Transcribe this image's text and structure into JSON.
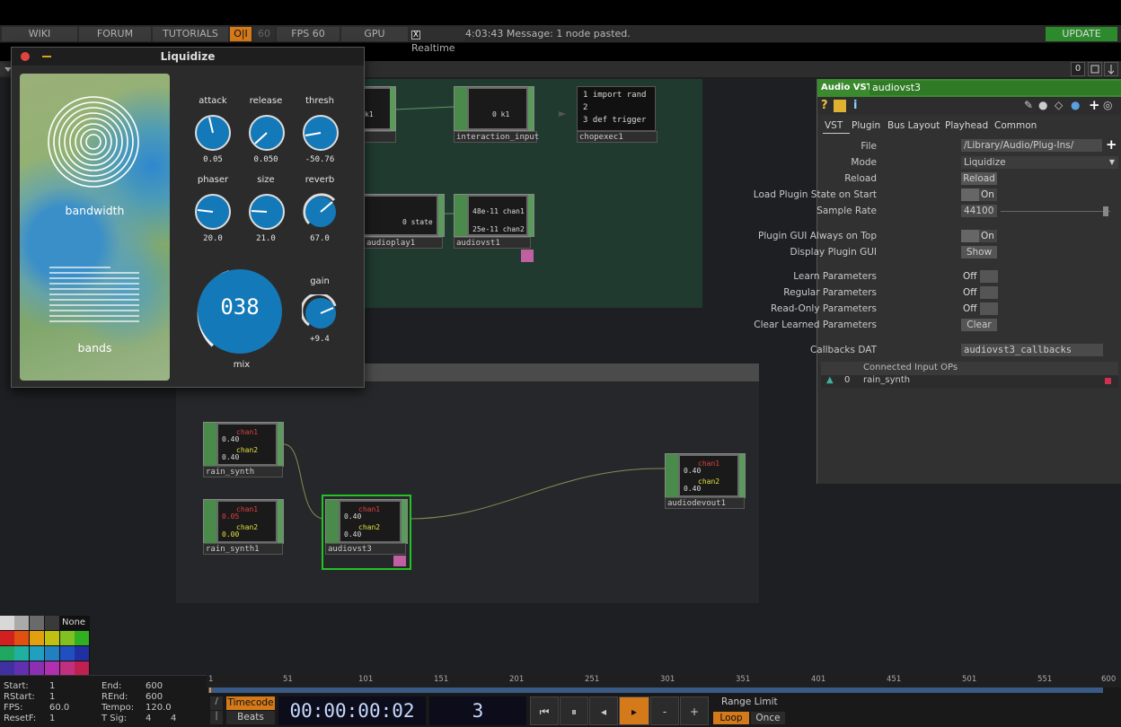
{
  "menubar": {
    "wiki": "WIKI",
    "forum": "FORUM",
    "tutorials": "TUTORIALS",
    "oi": "O|I",
    "oi_num": "60",
    "fps": "FPS  60",
    "gpu": "GPU",
    "realtime": "Realtime",
    "realtime_checked": "X",
    "status": "4:03:43 Message: 1 node pasted.",
    "update": "UPDATE"
  },
  "subbar": {
    "count": "0"
  },
  "plugin_window": {
    "title": "Liquidize",
    "art_labels": {
      "bandwidth": "bandwidth",
      "bands": "bands"
    },
    "knobs": [
      {
        "label": "attack",
        "value": "0.05"
      },
      {
        "label": "release",
        "value": "0.050"
      },
      {
        "label": "thresh",
        "value": "-50.76"
      },
      {
        "label": "phaser",
        "value": "20.0"
      },
      {
        "label": "size",
        "value": "21.0"
      },
      {
        "label": "reverb",
        "value": "67.0"
      }
    ],
    "mix": {
      "label": "mix",
      "value": "038"
    },
    "gain": {
      "label": "gain",
      "value": "+9.4"
    }
  },
  "nodes": {
    "interaction_input": {
      "name": "interaction_input",
      "readout": "0 k1"
    },
    "k1_left": {
      "readout": "k1"
    },
    "chopexec": {
      "name": "chopexec1",
      "code": [
        "1  import rand",
        "2",
        "3  def trigger"
      ]
    },
    "audioplay": {
      "name": "audioplay1",
      "readout": "0 state"
    },
    "audiovst1": {
      "name": "audiovst1",
      "readout": [
        "48e-11 chan1",
        "25e-11 chan2"
      ]
    },
    "rain_synth": {
      "name": "rain_synth",
      "readout": [
        "chan1",
        "0.40",
        "chan2",
        "0.40"
      ]
    },
    "rain_synth1": {
      "name": "rain_synth1",
      "readout": [
        "chan1",
        "0.05",
        "chan2",
        "0.00"
      ]
    },
    "audiovst3": {
      "name": "audiovst3",
      "readout": [
        "chan1",
        "0.40",
        "chan2",
        "0.40"
      ]
    },
    "audiodevout": {
      "name": "audiodevout1",
      "readout": [
        "chan1",
        "0.40",
        "chan2",
        "0.40"
      ]
    }
  },
  "panel": {
    "op_type": "Audio VST",
    "op_name": "audiovst3",
    "tabs": [
      "VST",
      "Plugin",
      "Bus Layout",
      "Playhead",
      "Common"
    ],
    "rows": {
      "file_label": "File",
      "file_value": "/Library/Audio/Plug-Ins/",
      "mode_label": "Mode",
      "mode_value": "Liquidize",
      "reload_label": "Reload",
      "reload_btn": "Reload",
      "loadstate_label": "Load Plugin State on Start",
      "loadstate_value": "On",
      "samplerate_label": "Sample Rate",
      "samplerate_value": "44100",
      "ontop_label": "Plugin GUI Always on Top",
      "ontop_value": "On",
      "display_label": "Display Plugin GUI",
      "display_btn": "Show",
      "learn_label": "Learn Parameters",
      "learn_value": "Off",
      "regular_label": "Regular Parameters",
      "regular_value": "Off",
      "readonly_label": "Read-Only Parameters",
      "readonly_value": "Off",
      "clear_label": "Clear Learned Parameters",
      "clear_btn": "Clear",
      "callbacks_label": "Callbacks DAT",
      "callbacks_value": "audiovst3_callbacks"
    },
    "connected": {
      "header": "Connected Input OPs",
      "rows": [
        {
          "index": "0",
          "name": "rain_synth"
        }
      ]
    }
  },
  "palette": {
    "none_label": "None"
  },
  "timeline": {
    "start_label": "Start:",
    "start": "1",
    "end_label": "End:",
    "end": "600",
    "rstart_label": "RStart:",
    "rstart": "1",
    "rend_label": "REnd:",
    "rend": "600",
    "fps_label": "FPS:",
    "fps": "60.0",
    "tempo_label": "Tempo:",
    "tempo": "120.0",
    "resetf_label": "ResetF:",
    "resetf": "1",
    "tsig_label": "T Sig:",
    "tsig_a": "4",
    "tsig_b": "4",
    "ticks": [
      "1",
      "51",
      "101",
      "151",
      "201",
      "251",
      "301",
      "351",
      "401",
      "451",
      "501",
      "551",
      "600"
    ],
    "timecode_btn": "Timecode",
    "beats_btn": "Beats",
    "timecode": "00:00:00:02",
    "frame": "3",
    "range_limit": "Range Limit",
    "loop": "Loop",
    "once": "Once"
  }
}
